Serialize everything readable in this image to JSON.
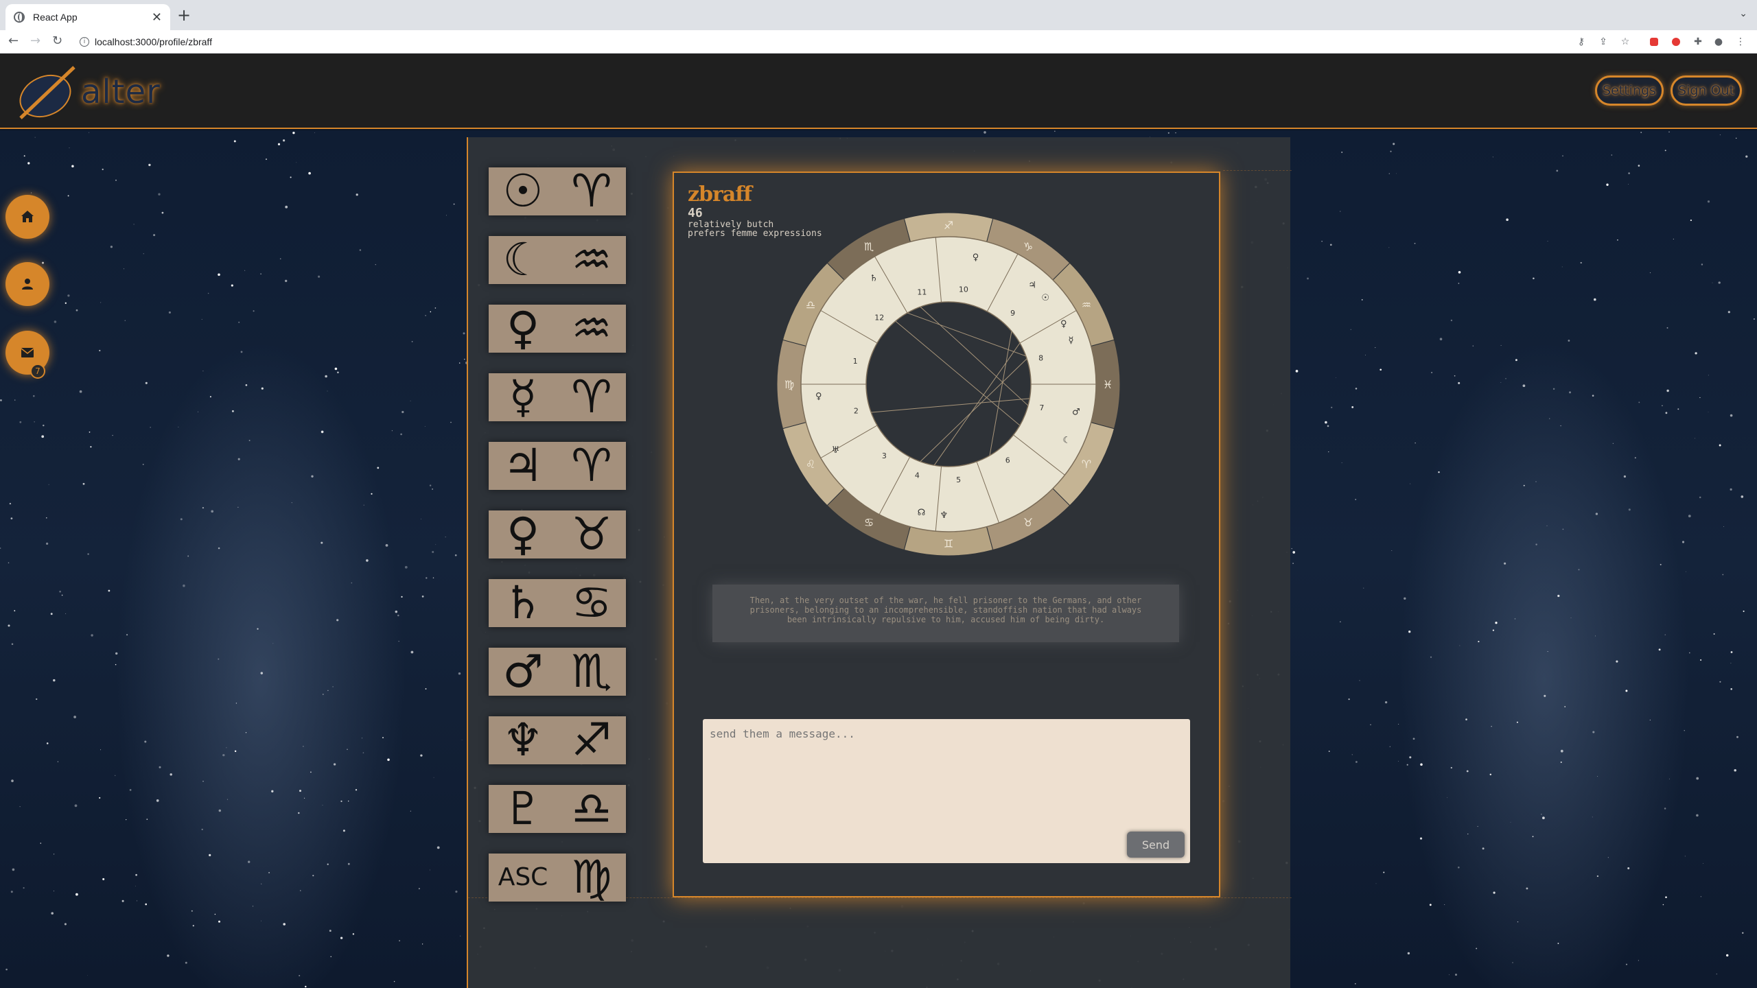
{
  "browser": {
    "tab_title": "React App",
    "tab_close": "✕",
    "new_tab": "+",
    "url": "localhost:3000/profile/zbraff"
  },
  "header": {
    "logo_text": "alter",
    "settings_label": "Settings",
    "signout_label": "Sign Out"
  },
  "sidebar": {
    "items": [
      {
        "name": "home",
        "icon": "home-icon"
      },
      {
        "name": "profile",
        "icon": "person-icon"
      },
      {
        "name": "messages",
        "icon": "mail-icon",
        "badge": "7"
      }
    ]
  },
  "placements": [
    {
      "planet": "☉",
      "planet_name": "sun-icon",
      "sign": "♈",
      "sign_name": "aries-icon"
    },
    {
      "planet": "☾",
      "planet_name": "moon-icon",
      "sign": "♒",
      "sign_name": "aquarius-icon"
    },
    {
      "planet": "♀",
      "planet_name": "venus-icon",
      "sign": "♒",
      "sign_name": "aquarius-icon"
    },
    {
      "planet": "☿",
      "planet_name": "mercury-icon",
      "sign": "♈",
      "sign_name": "aries-icon"
    },
    {
      "planet": "♃",
      "planet_name": "jupiter-icon",
      "sign": "♈",
      "sign_name": "aries-icon"
    },
    {
      "planet": "♀",
      "planet_name": "venus-icon",
      "sign": "♉",
      "sign_name": "taurus-icon"
    },
    {
      "planet": "♄",
      "planet_name": "saturn-icon",
      "sign": "♋",
      "sign_name": "cancer-icon"
    },
    {
      "planet": "♂",
      "planet_name": "mars-icon",
      "sign": "♏",
      "sign_name": "scorpio-icon"
    },
    {
      "planet": "♆",
      "planet_name": "neptune-icon",
      "sign": "♐",
      "sign_name": "sagittarius-icon"
    },
    {
      "planet": "♇",
      "planet_name": "pluto-icon",
      "sign": "♎",
      "sign_name": "libra-icon"
    },
    {
      "planet": "ASC",
      "planet_name": "ascendant-label",
      "sign": "♍",
      "sign_name": "virgo-icon"
    }
  ],
  "profile": {
    "username": "zbraff",
    "age": "46",
    "trait_1": "relatively butch",
    "trait_2": "prefers femme expressions",
    "quote": "Then, at the very outset of the war, he fell prisoner to the Germans, and other prisoners, belonging to an incomprehensible, standoffish nation that had always been intrinsically repulsive to him, accused him of being dirty."
  },
  "chart": {
    "signs_ccw_from_left": [
      "♍",
      "♌",
      "♋",
      "♊",
      "♉",
      "♈",
      "♓",
      "♒",
      "♑",
      "♐",
      "♏",
      "♎"
    ],
    "houses": [
      "1",
      "2",
      "3",
      "4",
      "5",
      "6",
      "7",
      "8",
      "9",
      "10",
      "11",
      "12"
    ],
    "planet_glyphs": [
      "♄",
      "♀",
      "♃",
      "☉",
      "♀",
      "☿",
      "♂",
      "☾",
      "♅",
      "☊",
      "♆",
      "♀"
    ]
  },
  "message": {
    "placeholder": "send them a message...",
    "send_label": "Send"
  },
  "colors": {
    "accent": "#d6862a",
    "tile": "#a4907c",
    "card": "#2e3237",
    "input_bg": "#eee0d0"
  }
}
